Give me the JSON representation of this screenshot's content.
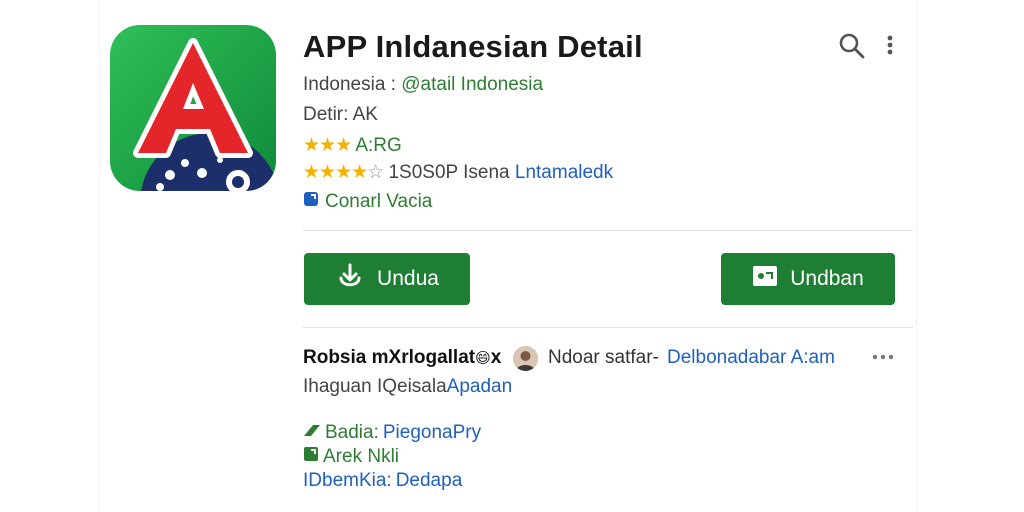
{
  "app": {
    "title": "APP Inldanesian Detail",
    "developer_label": "Indonesia :",
    "developer_link": "@atail Indonesia",
    "detail_line": "Detir: AK",
    "rating_short": "A:RG",
    "stars_primary": "★★★",
    "stars_secondary": "★★★★",
    "star_empty": "☆",
    "rating_text": "1S0S0P Isena",
    "rating_link": "Lntamaledk",
    "category": "Conarl Vacia"
  },
  "buttons": {
    "download_label": "Undua",
    "open_label": "Undban"
  },
  "review": {
    "title": "Robsia mXrlogallat",
    "emoji": "😄",
    "title_suffix": "x",
    "reviewer": "Ndoar satfar-",
    "link": "Delbonadabar A:am",
    "sub_text": "Ihaguan IQeisala",
    "sub_link": "Apadan"
  },
  "meta": [
    {
      "label": "Badia:",
      "value": "PiegonaPry"
    },
    {
      "label": "Arek Nkli",
      "value": ""
    },
    {
      "label": "IDbemKia:",
      "value": "Dedapa"
    }
  ],
  "icons": [
    "app-logo-icon",
    "search-icon",
    "more-vert-icon",
    "download-icon",
    "open-app-icon",
    "more-horiz-icon",
    "category-icon",
    "tag-icon"
  ],
  "colors": {
    "accent_green": "#1e7e34",
    "link_green": "#2e7d32",
    "link_blue": "#1f5fbf",
    "star": "#f2b203"
  }
}
